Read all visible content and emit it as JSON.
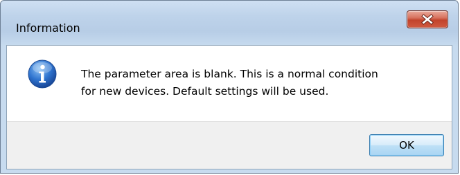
{
  "window": {
    "title": "Information"
  },
  "titlebar": {
    "close_icon": "close-icon",
    "close_color": "#c7432b"
  },
  "dialog": {
    "icon": "info-icon",
    "icon_color": "#2a6fc9",
    "message_line1": "The parameter area is blank. This is a normal condition",
    "message_line2": "for new devices. Default settings will be used."
  },
  "buttons": {
    "ok_label": "OK"
  }
}
